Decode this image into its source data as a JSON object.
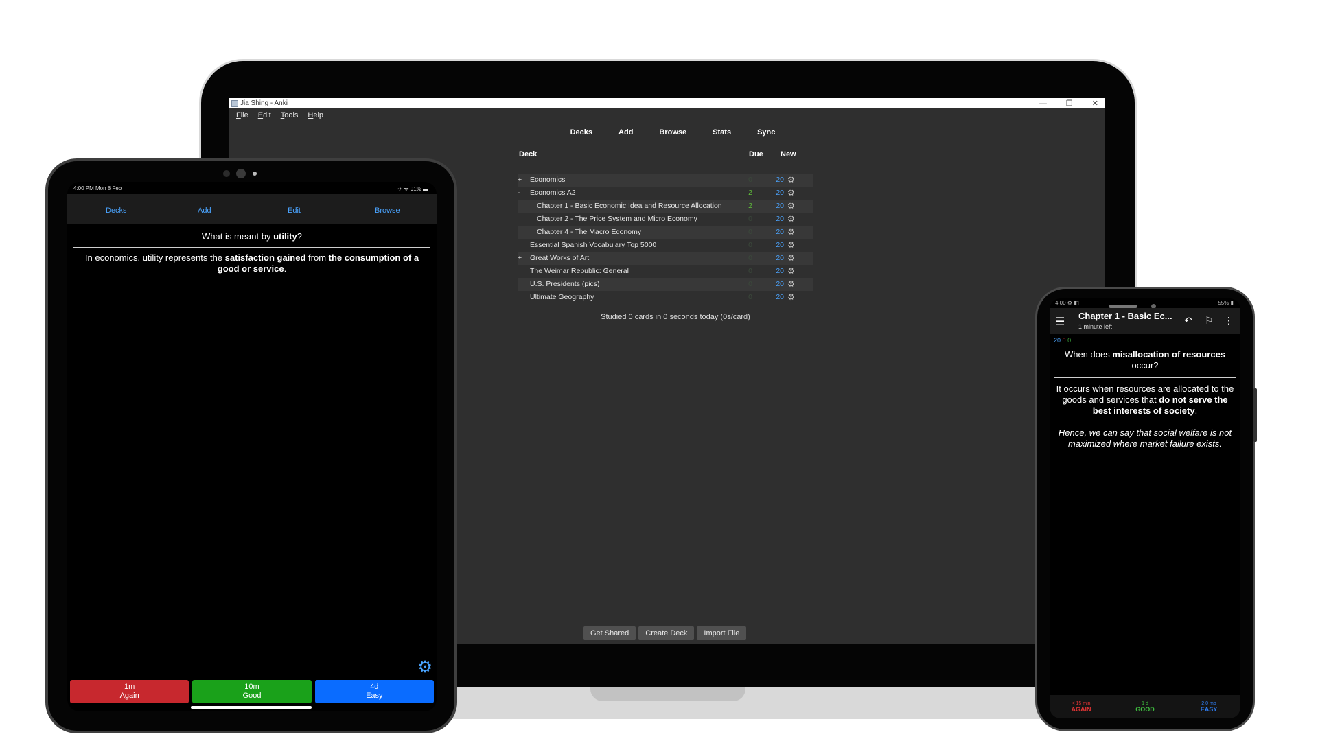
{
  "laptop": {
    "window_title": "Jia Shing - Anki",
    "window_controls": [
      "—",
      "❐",
      "✕"
    ],
    "menu": [
      "File",
      "Edit",
      "Tools",
      "Help"
    ],
    "nav": [
      "Decks",
      "Add",
      "Browse",
      "Stats",
      "Sync"
    ],
    "columns": {
      "deck": "Deck",
      "due": "Due",
      "new": "New"
    },
    "decks": [
      {
        "prefix": "+",
        "name": "Economics",
        "due": "0",
        "new": "20",
        "level": 0,
        "due_green": false
      },
      {
        "prefix": "-",
        "name": "Economics A2",
        "due": "2",
        "new": "20",
        "level": 0,
        "due_green": true
      },
      {
        "prefix": "",
        "name": "Chapter 1 - Basic Economic Idea and Resource Allocation",
        "due": "2",
        "new": "20",
        "level": 1,
        "due_green": true
      },
      {
        "prefix": "",
        "name": "Chapter 2 - The Price System and Micro Economy",
        "due": "0",
        "new": "20",
        "level": 1,
        "due_green": false
      },
      {
        "prefix": "",
        "name": "Chapter 4 - The Macro Economy",
        "due": "0",
        "new": "20",
        "level": 1,
        "due_green": false
      },
      {
        "prefix": "",
        "name": "Essential Spanish Vocabulary Top 5000",
        "due": "0",
        "new": "20",
        "level": 0,
        "due_green": false
      },
      {
        "prefix": "+",
        "name": "Great Works of Art",
        "due": "0",
        "new": "20",
        "level": 0,
        "due_green": false
      },
      {
        "prefix": "",
        "name": "The Weimar Republic: General",
        "due": "0",
        "new": "20",
        "level": 0,
        "due_green": false
      },
      {
        "prefix": "",
        "name": "U.S. Presidents (pics)",
        "due": "0",
        "new": "20",
        "level": 0,
        "due_green": false
      },
      {
        "prefix": "",
        "name": "Ultimate Geography",
        "due": "0",
        "new": "20",
        "level": 0,
        "due_green": false
      }
    ],
    "studied": "Studied 0 cards in 0 seconds today (0s/card)",
    "bottom_buttons": [
      "Get Shared",
      "Create Deck",
      "Import File"
    ]
  },
  "tablet": {
    "status_left": "4:00 PM   Mon 8 Feb",
    "status_right": "✈ ᯤ 91% ▬",
    "nav": [
      "Decks",
      "Add",
      "Edit",
      "Browse"
    ],
    "question": {
      "pre": "What is meant by ",
      "bold": "utility",
      "post": "?"
    },
    "answer": {
      "p1": "In economics. utility represents the ",
      "b1": "satisfaction gained",
      "p2": " from ",
      "b2": "the consumption of a good or service",
      "p3": "."
    },
    "buttons": [
      {
        "time": "1m",
        "label": "Again"
      },
      {
        "time": "10m",
        "label": "Good"
      },
      {
        "time": "4d",
        "label": "Easy"
      }
    ],
    "colors": {
      "again": "#c7282e",
      "good": "#1aa11a",
      "easy": "#0a6cff"
    }
  },
  "phone": {
    "status_left": "4:00 ⚙ ◧",
    "status_right": "55% ▮",
    "title": "Chapter 1 - Basic Ec...",
    "subtitle": "1 minute left",
    "counts": {
      "new": "20",
      "learn": "0",
      "review": "0"
    },
    "question": {
      "pre": "When does ",
      "bold": "misallocation of resources",
      "post": " occur?"
    },
    "answer": {
      "p1": "It occurs when resources are allocated to the goods and services that ",
      "b1": "do not serve the best interests of society",
      "p2": "."
    },
    "note": "Hence, we can say that social welfare is not maximized where market failure exists.",
    "buttons": [
      {
        "time": "< 15 min",
        "label": "AGAIN"
      },
      {
        "time": "1 d",
        "label": "GOOD"
      },
      {
        "time": "2.0 mo",
        "label": "EASY"
      }
    ]
  }
}
